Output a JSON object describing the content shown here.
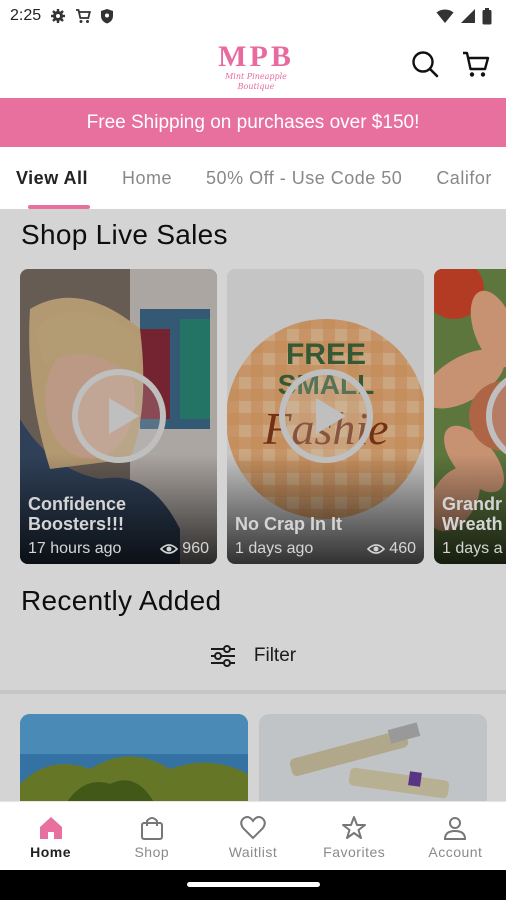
{
  "status_bar": {
    "time": "2:25",
    "icons": [
      "settings-icon",
      "cart-icon",
      "shield-icon",
      "wifi-icon",
      "signal-icon",
      "battery-icon"
    ]
  },
  "header": {
    "logo_text": "MPB",
    "logo_tagline": "Mint Pineapple Boutique",
    "icons": [
      "search-icon",
      "cart-icon"
    ],
    "brand_color": "#e8709f"
  },
  "promo": {
    "text": "Free Shipping on purchases over $150!"
  },
  "tabs": [
    {
      "label": "View All",
      "active": true
    },
    {
      "label": "Home"
    },
    {
      "label": "50% Off - Use Code 50"
    },
    {
      "label": "Califor"
    }
  ],
  "live_sales": {
    "title": "Shop Live Sales",
    "videos": [
      {
        "title": "Confidence Boosters!!!",
        "time": "17 hours ago",
        "views": "960"
      },
      {
        "title": "No Crap In It",
        "time": "1 days ago",
        "views": "460",
        "graphic_text": [
          "FREE",
          "SMALL",
          "Fashie"
        ]
      },
      {
        "title": "Grandr Wreath",
        "time": "1 days a",
        "views": ""
      }
    ]
  },
  "recently_added": {
    "title": "Recently Added",
    "filter_label": "Filter"
  },
  "bottom_nav": [
    {
      "label": "Home",
      "icon": "home-icon",
      "active": true
    },
    {
      "label": "Shop",
      "icon": "shopping-bag-icon"
    },
    {
      "label": "Waitlist",
      "icon": "heart-icon"
    },
    {
      "label": "Favorites",
      "icon": "star-icon"
    },
    {
      "label": "Account",
      "icon": "person-icon"
    }
  ]
}
